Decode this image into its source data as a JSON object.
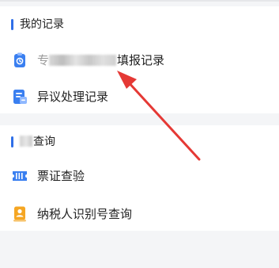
{
  "records_section": {
    "title": "我的记录",
    "items": [
      {
        "label_prefix": "专",
        "label": "填报记录"
      },
      {
        "label": "异议处理记录"
      }
    ]
  },
  "query_section": {
    "title": "查询",
    "items": [
      {
        "label": "票证查验"
      },
      {
        "label": "纳税人识别号查询"
      }
    ]
  },
  "colors": {
    "accent": "#2f6fe8",
    "annotation_arrow": "#e53935",
    "icon_orange": "#f5a623"
  }
}
